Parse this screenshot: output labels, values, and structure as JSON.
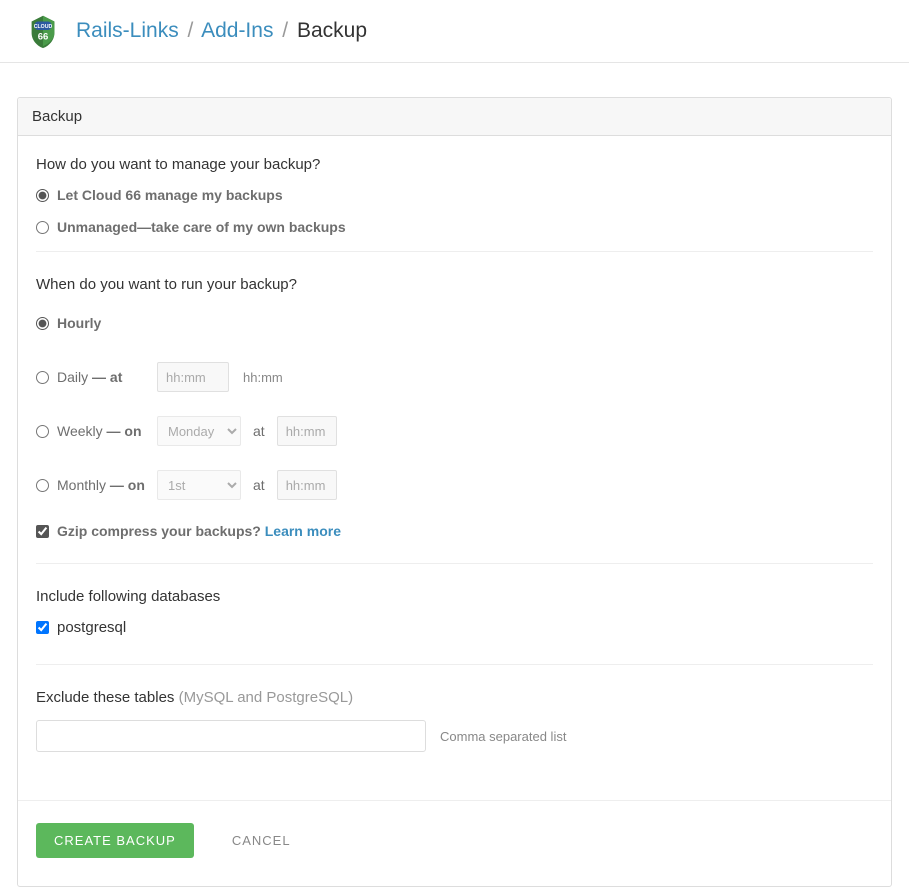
{
  "breadcrumb": {
    "item1": "Rails-Links",
    "item2": "Add-Ins",
    "current": "Backup",
    "sep": "/"
  },
  "panel": {
    "title": "Backup"
  },
  "manage": {
    "question": "How do you want to manage your backup?",
    "opt_managed": "Let Cloud 66 manage my backups",
    "opt_unmanaged": "Unmanaged—take care of my own backups"
  },
  "schedule": {
    "question": "When do you want to run your backup?",
    "hourly": "Hourly",
    "daily": "Daily",
    "weekly": "Weekly",
    "monthly": "Monthly",
    "at": "— at",
    "on": "— on",
    "at_plain": "at",
    "hhmm_placeholder": "hh:mm",
    "hhmm_hint": "hh:mm",
    "day_selected": "Monday",
    "dom_selected": "1st"
  },
  "gzip": {
    "label": "Gzip compress your backups?",
    "learn_more": "Learn more"
  },
  "databases": {
    "heading": "Include following databases",
    "item1": "postgresql"
  },
  "exclude": {
    "label": "Exclude these tables",
    "hint_paren": "(MySQL and PostgreSQL)",
    "hint": "Comma separated list"
  },
  "actions": {
    "create": "CREATE BACKUP",
    "cancel": "CANCEL"
  }
}
